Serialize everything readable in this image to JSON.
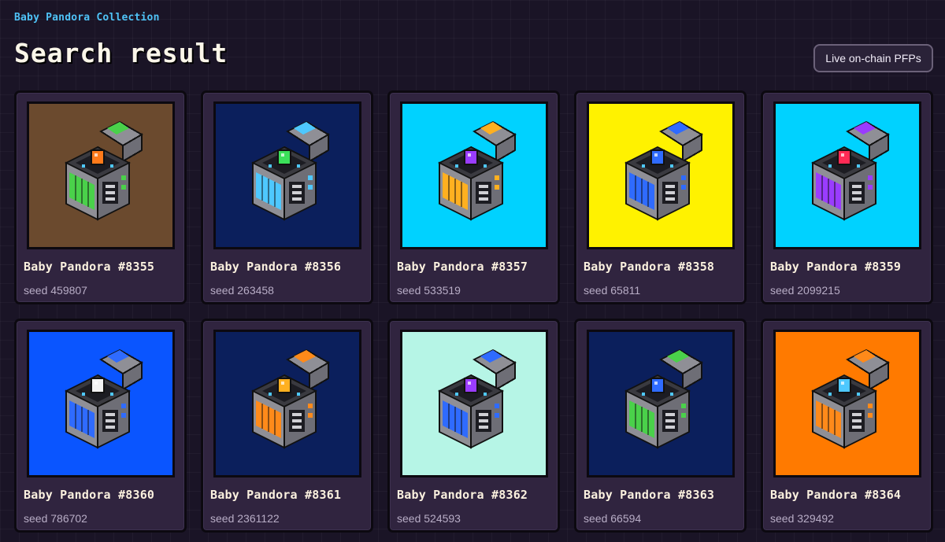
{
  "header": {
    "breadcrumb": "Baby Pandora Collection",
    "title": "Search result",
    "action_label": "Live on-chain PFPs"
  },
  "colors": {
    "page_background": "#1a1426",
    "card_background": "#30243f",
    "breadcrumb": "#4fc3f7"
  },
  "items": [
    {
      "name": "Baby Pandora #8355",
      "seed": "seed 459807",
      "bg": "#6b4a2e",
      "accent": "#4ad14a",
      "gem": "#ff7a1a",
      "icon": "pandora-box-icon"
    },
    {
      "name": "Baby Pandora #8356",
      "seed": "seed 263458",
      "bg": "#0b1f5c",
      "accent": "#4ec8ff",
      "gem": "#3be05a",
      "icon": "pandora-box-icon"
    },
    {
      "name": "Baby Pandora #8357",
      "seed": "seed 533519",
      "bg": "#00d2ff",
      "accent": "#ffb020",
      "gem": "#9a3cff",
      "icon": "pandora-box-icon"
    },
    {
      "name": "Baby Pandora #8358",
      "seed": "seed 65811",
      "bg": "#fff200",
      "accent": "#2f6bff",
      "gem": "#2f6bff",
      "icon": "pandora-box-icon"
    },
    {
      "name": "Baby Pandora #8359",
      "seed": "seed 2099215",
      "bg": "#00d2ff",
      "accent": "#9a3cff",
      "gem": "#ff2a55",
      "icon": "pandora-box-icon"
    },
    {
      "name": "Baby Pandora #8360",
      "seed": "seed 786702",
      "bg": "#0a55ff",
      "accent": "#2f6bff",
      "gem": "#f2f2f2",
      "icon": "pandora-box-icon"
    },
    {
      "name": "Baby Pandora #8361",
      "seed": "seed 2361122",
      "bg": "#0b1f5c",
      "accent": "#ff8a1a",
      "gem": "#ffb020",
      "icon": "pandora-box-icon"
    },
    {
      "name": "Baby Pandora #8362",
      "seed": "seed 524593",
      "bg": "#b6f5e6",
      "accent": "#2f6bff",
      "gem": "#9a3cff",
      "icon": "pandora-box-icon"
    },
    {
      "name": "Baby Pandora #8363",
      "seed": "seed 66594",
      "bg": "#0b1f5c",
      "accent": "#4ad14a",
      "gem": "#2f6bff",
      "icon": "pandora-box-icon"
    },
    {
      "name": "Baby Pandora #8364",
      "seed": "seed 329492",
      "bg": "#ff7a00",
      "accent": "#ff8a1a",
      "gem": "#4ec8ff",
      "icon": "pandora-box-icon"
    }
  ]
}
